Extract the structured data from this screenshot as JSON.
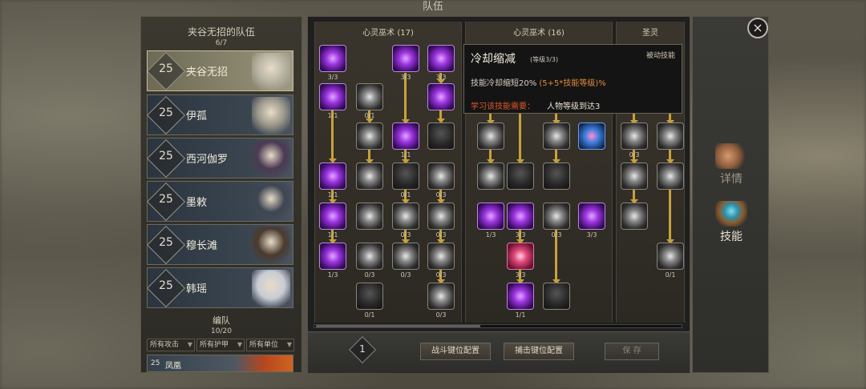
{
  "screen_title": "队伍",
  "close_label": "×",
  "team": {
    "title": "夹谷无招的队伍",
    "count": "6/7",
    "members": [
      {
        "level": "25",
        "name": "夹谷无招",
        "active": true,
        "portrait_color": "#b8b4a4"
      },
      {
        "level": "25",
        "name": "伊孤",
        "active": false,
        "portrait_color": "#9a9688"
      },
      {
        "level": "25",
        "name": "西河伽罗",
        "active": false,
        "portrait_color": "#4b3a52"
      },
      {
        "level": "25",
        "name": "墨敕",
        "active": false,
        "portrait_color": "#3f4652"
      },
      {
        "level": "25",
        "name": "穆长滩",
        "active": false,
        "portrait_color": "#4a3a2e"
      },
      {
        "level": "25",
        "name": "韩瑶",
        "active": false,
        "portrait_color": "#c9ccd4"
      }
    ]
  },
  "formation": {
    "title": "编队",
    "count": "10/20",
    "filters": [
      "所有攻击",
      "所有护甲",
      "所有单位"
    ],
    "unit": {
      "level": "25",
      "name": "凤凰"
    }
  },
  "skill_trees": [
    {
      "title": "心灵巫术 (17)"
    },
    {
      "title": "心灵巫术 (16)"
    },
    {
      "title": "圣灵"
    }
  ],
  "nodes": {
    "t1": [
      {
        "style": "purple",
        "count": "3/3"
      },
      {
        "style": "purple",
        "count": "3/3"
      },
      {
        "style": "purple",
        "count": "3/3"
      },
      {
        "style": "purple",
        "count": "1/1"
      },
      {
        "style": "grey",
        "count": "0/1"
      },
      {
        "style": "purple",
        "count": ""
      },
      {
        "style": "grey",
        "count": ""
      },
      {
        "style": "purple",
        "count": "1/1"
      },
      {
        "style": "dark",
        "count": ""
      },
      {
        "style": "purple",
        "count": "1/1"
      },
      {
        "style": "grey",
        "count": ""
      },
      {
        "style": "dark",
        "count": "0/1"
      },
      {
        "style": "grey",
        "count": "0/3"
      },
      {
        "style": "purple",
        "count": "1/1"
      },
      {
        "style": "grey",
        "count": ""
      },
      {
        "style": "grey",
        "count": "0/3"
      },
      {
        "style": "grey",
        "count": "0/3"
      },
      {
        "style": "purple",
        "count": "1/3"
      },
      {
        "style": "grey",
        "count": "0/3"
      },
      {
        "style": "grey",
        "count": "0/3"
      },
      {
        "style": "grey",
        "count": "0/3"
      },
      {
        "style": "dark",
        "count": "0/1"
      },
      {
        "style": "grey",
        "count": "0/3"
      }
    ],
    "t2": [
      {
        "style": "grey",
        "count": ""
      },
      {
        "style": "grey",
        "count": ""
      },
      {
        "style": "blue",
        "count": ""
      },
      {
        "style": "grey",
        "count": ""
      },
      {
        "style": "dark",
        "count": ""
      },
      {
        "style": "dark",
        "count": ""
      },
      {
        "style": "purple",
        "count": "1/3"
      },
      {
        "style": "purple",
        "count": "3/3"
      },
      {
        "style": "grey",
        "count": "0/3"
      },
      {
        "style": "purple",
        "count": "3/3"
      },
      {
        "style": "pink",
        "count": "3/3"
      },
      {
        "style": "purple",
        "count": "1/1"
      },
      {
        "style": "dark",
        "count": ""
      }
    ],
    "t3": [
      {
        "style": "grey",
        "count": "0/3"
      },
      {
        "style": "grey",
        "count": ""
      },
      {
        "style": "grey",
        "count": ""
      },
      {
        "style": "grey",
        "count": ""
      },
      {
        "style": "grey",
        "count": ""
      },
      {
        "style": "grey",
        "count": "0/1"
      }
    ]
  },
  "footer": {
    "skill_points": "1",
    "battle_keys": "战斗键位配置",
    "capture_keys": "捕击键位配置",
    "save": "保 存"
  },
  "tooltip": {
    "name": "冷却缩减",
    "level": "(等级3/3)",
    "type": "被动技能",
    "desc": "技能冷却缩短20% ",
    "formula": "(5+5*技能等级)%",
    "req_label": "学习该技能需要：",
    "req": "人物等级到达3"
  },
  "right_tabs": [
    {
      "label": "详情",
      "active": false
    },
    {
      "label": "技能",
      "active": true
    }
  ]
}
